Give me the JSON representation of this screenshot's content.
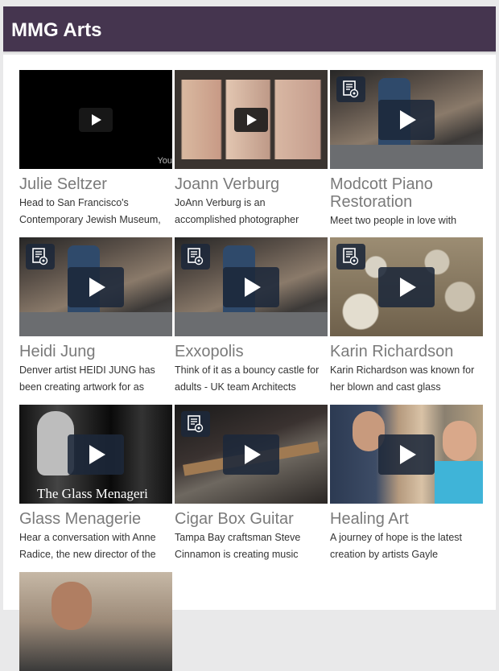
{
  "app": {
    "title": "MMG Arts"
  },
  "colors": {
    "header_bg": "#45354f",
    "play_bg": "#1c283a"
  },
  "videos": [
    {
      "title": "Julie Seltzer",
      "desc": "Head to San Francisco's Contemporary Jewish Museum,",
      "thumb": "dark",
      "icon": "play-icon",
      "watermark": "You"
    },
    {
      "title": "Joann Verburg",
      "desc": "JoAnn Verburg is an accomplished photographer",
      "thumb": "photos",
      "icon": "play-icon"
    },
    {
      "title": "Modcott Piano Restoration",
      "desc": "Meet two people in love with",
      "thumb": "piano",
      "icon": "play-icon"
    },
    {
      "title": "Heidi Jung",
      "desc": "Denver artist HEIDI JUNG has been creating artwork for as",
      "thumb": "piano",
      "icon": "play-icon"
    },
    {
      "title": "Exxopolis",
      "desc": "Think of it as a bouncy castle for adults - UK team Architects",
      "thumb": "piano",
      "icon": "play-icon"
    },
    {
      "title": "Karin Richardson",
      "desc": "Karin Richardson was known for her blown and cast glass",
      "thumb": "shells",
      "icon": "play-icon"
    },
    {
      "title": "Glass Menagerie",
      "desc": "Hear a conversation with Anne Radice, the new director of the",
      "thumb": "bw",
      "icon": "play-icon",
      "overlay": "The Glass Menageri"
    },
    {
      "title": "Cigar Box Guitar",
      "desc": "Tampa Bay craftsman Steve Cinnamon is creating music",
      "thumb": "guitar",
      "icon": "play-icon"
    },
    {
      "title": "Healing Art",
      "desc": "A journey of hope is the latest creation by artists Gayle",
      "thumb": "people",
      "icon": "play-icon"
    }
  ]
}
